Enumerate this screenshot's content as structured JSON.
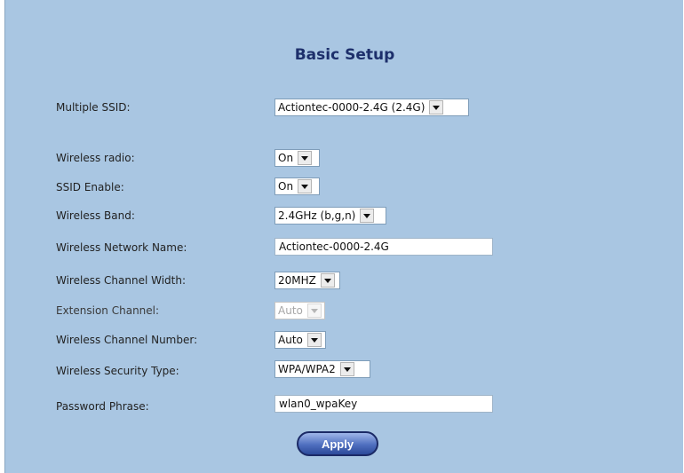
{
  "page": {
    "title": "Basic Setup",
    "apply_label": "Apply"
  },
  "fields": {
    "multiple_ssid": {
      "label": "Multiple SSID:",
      "value": "Actiontec-0000-2.4G (2.4G)"
    },
    "wireless_radio": {
      "label": "Wireless radio:",
      "value": "On"
    },
    "ssid_enable": {
      "label": "SSID Enable:",
      "value": "On"
    },
    "wireless_band": {
      "label": "Wireless Band:",
      "value": "2.4GHz (b,g,n)"
    },
    "network_name": {
      "label": "Wireless Network Name:",
      "value": "Actiontec-0000-2.4G"
    },
    "channel_width": {
      "label": "Wireless Channel Width:",
      "value": "20MHZ"
    },
    "extension_channel": {
      "label": "Extension Channel:",
      "value": "Auto",
      "disabled": true
    },
    "channel_number": {
      "label": "Wireless Channel Number:",
      "value": "Auto"
    },
    "security_type": {
      "label": "Wireless Security Type:",
      "value": "WPA/WPA2"
    },
    "password_phrase": {
      "label": "Password Phrase:",
      "value": "wlan0_wpaKey"
    }
  },
  "colors": {
    "panel_background": "#a9c6e2",
    "title_color": "#1d2f6b",
    "button_dark": "#1b2a66"
  }
}
